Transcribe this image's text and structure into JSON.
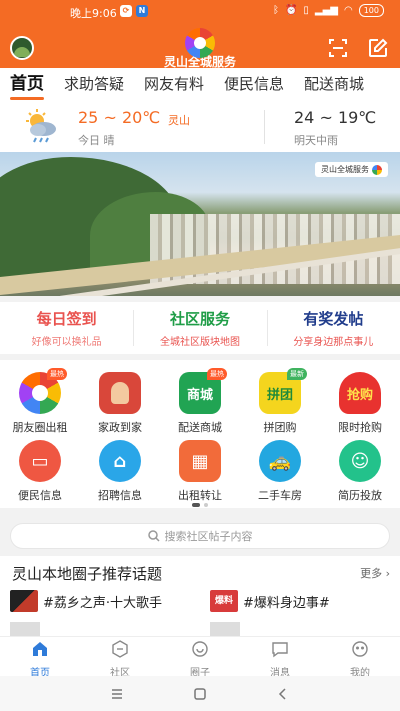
{
  "status_bar": {
    "time": "晚上9:06",
    "battery": "100"
  },
  "header": {
    "app_title": "灵山全城服务"
  },
  "tabs": [
    {
      "label": "首页",
      "active": true
    },
    {
      "label": "求助答疑",
      "active": false
    },
    {
      "label": "网友有料",
      "active": false
    },
    {
      "label": "便民信息",
      "active": false
    },
    {
      "label": "配送商城",
      "active": false
    }
  ],
  "weather": {
    "today_temp": "25 ~ 20℃",
    "location": "灵山",
    "today_label": "今日 晴",
    "tomorrow_temp": "24 ~ 19℃",
    "tomorrow_label": "明天中雨"
  },
  "banner": {
    "badge_text": "灵山全城服务"
  },
  "features": [
    {
      "title": "每日签到",
      "subtitle": "好像可以换礼品"
    },
    {
      "title": "社区服务",
      "subtitle": "全城社区版块地图"
    },
    {
      "title": "有奖发帖",
      "subtitle": "分享身边那点事儿"
    }
  ],
  "grid_badges": {
    "hot": "最热",
    "new": "最新"
  },
  "services": [
    {
      "label": "朋友圈出租",
      "icon": "aperture-icon",
      "icon_text": ""
    },
    {
      "label": "家政到家",
      "icon": "housekeeping-icon",
      "icon_text": ""
    },
    {
      "label": "配送商城",
      "icon": "mall-icon",
      "icon_text": "商城"
    },
    {
      "label": "拼团购",
      "icon": "group-buy-icon",
      "icon_text": "拼团"
    },
    {
      "label": "限时抢购",
      "icon": "flash-sale-icon",
      "icon_text": "抢购"
    },
    {
      "label": "便民信息",
      "icon": "basket-icon",
      "icon_text": ""
    },
    {
      "label": "招聘信息",
      "icon": "house-face-icon",
      "icon_text": ""
    },
    {
      "label": "出租转让",
      "icon": "building-icon",
      "icon_text": ""
    },
    {
      "label": "二手车房",
      "icon": "car-icon",
      "icon_text": ""
    },
    {
      "label": "简历投放",
      "icon": "resume-icon",
      "icon_text": ""
    }
  ],
  "search": {
    "placeholder": "搜索社区帖子内容"
  },
  "topics": {
    "title": "灵山本地圈子推荐话题",
    "more": "更多",
    "items": [
      {
        "text": "#荔乡之声·十大歌手",
        "thumb": ""
      },
      {
        "text": "#爆料身边事#",
        "thumb": "爆料"
      }
    ]
  },
  "bottom_nav": [
    {
      "label": "首页",
      "active": true
    },
    {
      "label": "社区",
      "active": false
    },
    {
      "label": "圈子",
      "active": false
    },
    {
      "label": "消息",
      "active": false
    },
    {
      "label": "我的",
      "active": false
    }
  ],
  "colors": {
    "brand_orange": "#f46b24",
    "active_blue": "#2f7bd9"
  }
}
